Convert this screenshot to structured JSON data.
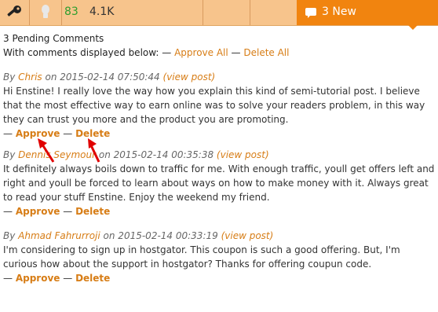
{
  "toolbar": {
    "approved_count": "83",
    "view_count": "4.1K",
    "new_label": "3 New"
  },
  "summary": {
    "pending_title": "3 Pending Comments",
    "bulk_prefix": "With comments displayed below: — ",
    "approve_all": "Approve All",
    "separator": " — ",
    "delete_all": "Delete All"
  },
  "comments": [
    {
      "by": "By ",
      "author": "Chris",
      "date": " on 2015-02-14 07:50:44 ",
      "view_post": "(view post)",
      "text": "Hi Enstine! I really love the way how you explain this kind of semi-tutorial post. I believe that the most effective way to earn online was to solve your readers problem, in this way they can trust you more and the product you are promoting.",
      "approve": "Approve",
      "delete": "Delete"
    },
    {
      "by": "By ",
      "author": "Dennis Seymour",
      "date": " on 2015-02-14 00:35:38 ",
      "view_post": "(view post)",
      "text": "It definitely always boils down to traffic for me. With enough traffic, youll get offers left and right and youll be forced to learn about ways on how to make money with it. Always great to read your stuff Enstine. Enjoy the weekend my friend.",
      "approve": "Approve",
      "delete": "Delete"
    },
    {
      "by": "By ",
      "author": "Ahmad Fahrurroji",
      "date": " on 2015-02-14 00:33:19 ",
      "view_post": "(view post)",
      "text": "I'm considering to sign up in hostgator. This coupon is such a good offering. But, I'm curious how about the support in hostgator? Thanks for offering coupun code.",
      "approve": "Approve",
      "delete": "Delete"
    }
  ],
  "colors": {
    "toolbar_bg": "#f7c48c",
    "accent": "#f1840f",
    "link": "#d77d16",
    "green_count": "#2e9e2e",
    "annotation_arrow": "#e00000"
  }
}
